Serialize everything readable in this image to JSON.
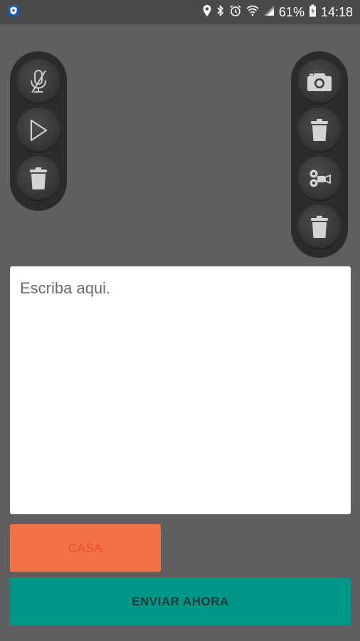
{
  "status_bar": {
    "battery_percent": "61%",
    "time": "14:18",
    "icons": [
      "app-shield-icon",
      "location-icon",
      "bluetooth-icon",
      "alarm-icon",
      "wifi-icon",
      "signal-icon",
      "battery-icon"
    ]
  },
  "audio_controls": {
    "icons": [
      "mic-off-icon",
      "play-icon",
      "trash-icon"
    ]
  },
  "media_controls": {
    "icons": [
      "camera-icon",
      "trash-icon",
      "video-camera-icon",
      "trash-icon"
    ]
  },
  "note": {
    "placeholder": "Escriba aqui.",
    "value": ""
  },
  "buttons": {
    "casa_label": "CASA",
    "send_label": "ENVIAR AHORA"
  },
  "colors": {
    "background": "#5f5f5f",
    "casa_button": "#f47048",
    "send_button": "#009688"
  }
}
